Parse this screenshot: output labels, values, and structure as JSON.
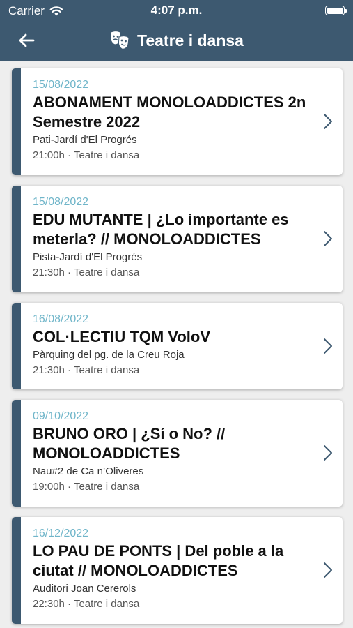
{
  "status_bar": {
    "carrier": "Carrier",
    "time": "4:07 p.m."
  },
  "nav": {
    "title": "Teatre i dansa",
    "back_icon": "arrow-left-icon",
    "title_icon": "theater-masks-icon"
  },
  "colors": {
    "header": "#3d5970",
    "accent_bar": "#3d5970",
    "date": "#6fb5c9",
    "background": "#eeeeee"
  },
  "events": [
    {
      "date": "15/08/2022",
      "title": "ABONAMENT MONOLOADDICTES 2n Semestre 2022",
      "venue": "Pati-Jardí d'El Progrés",
      "time": "21:00h",
      "category": "Teatre i dansa"
    },
    {
      "date": "15/08/2022",
      "title": "EDU MUTANTE | ¿Lo importante es meterla? // MONOLOADDICTES",
      "venue": "Pista-Jardí d'El Progrés",
      "time": "21:30h",
      "category": "Teatre i dansa"
    },
    {
      "date": "16/08/2022",
      "title": "COL·LECTIU TQM VoloV",
      "venue": "Pàrquing del pg. de la Creu Roja",
      "time": "21:30h",
      "category": "Teatre i dansa"
    },
    {
      "date": "09/10/2022",
      "title": "BRUNO ORO | ¿Sí o No? // MONOLOADDICTES",
      "venue": "Nau#2 de Ca n’Oliveres",
      "time": "19:00h",
      "category": "Teatre i dansa"
    },
    {
      "date": "16/12/2022",
      "title": "LO PAU DE PONTS | Del poble a la ciutat // MONOLOADDICTES",
      "venue": "Auditori Joan Cererols",
      "time": "22:30h",
      "category": "Teatre i dansa"
    }
  ]
}
